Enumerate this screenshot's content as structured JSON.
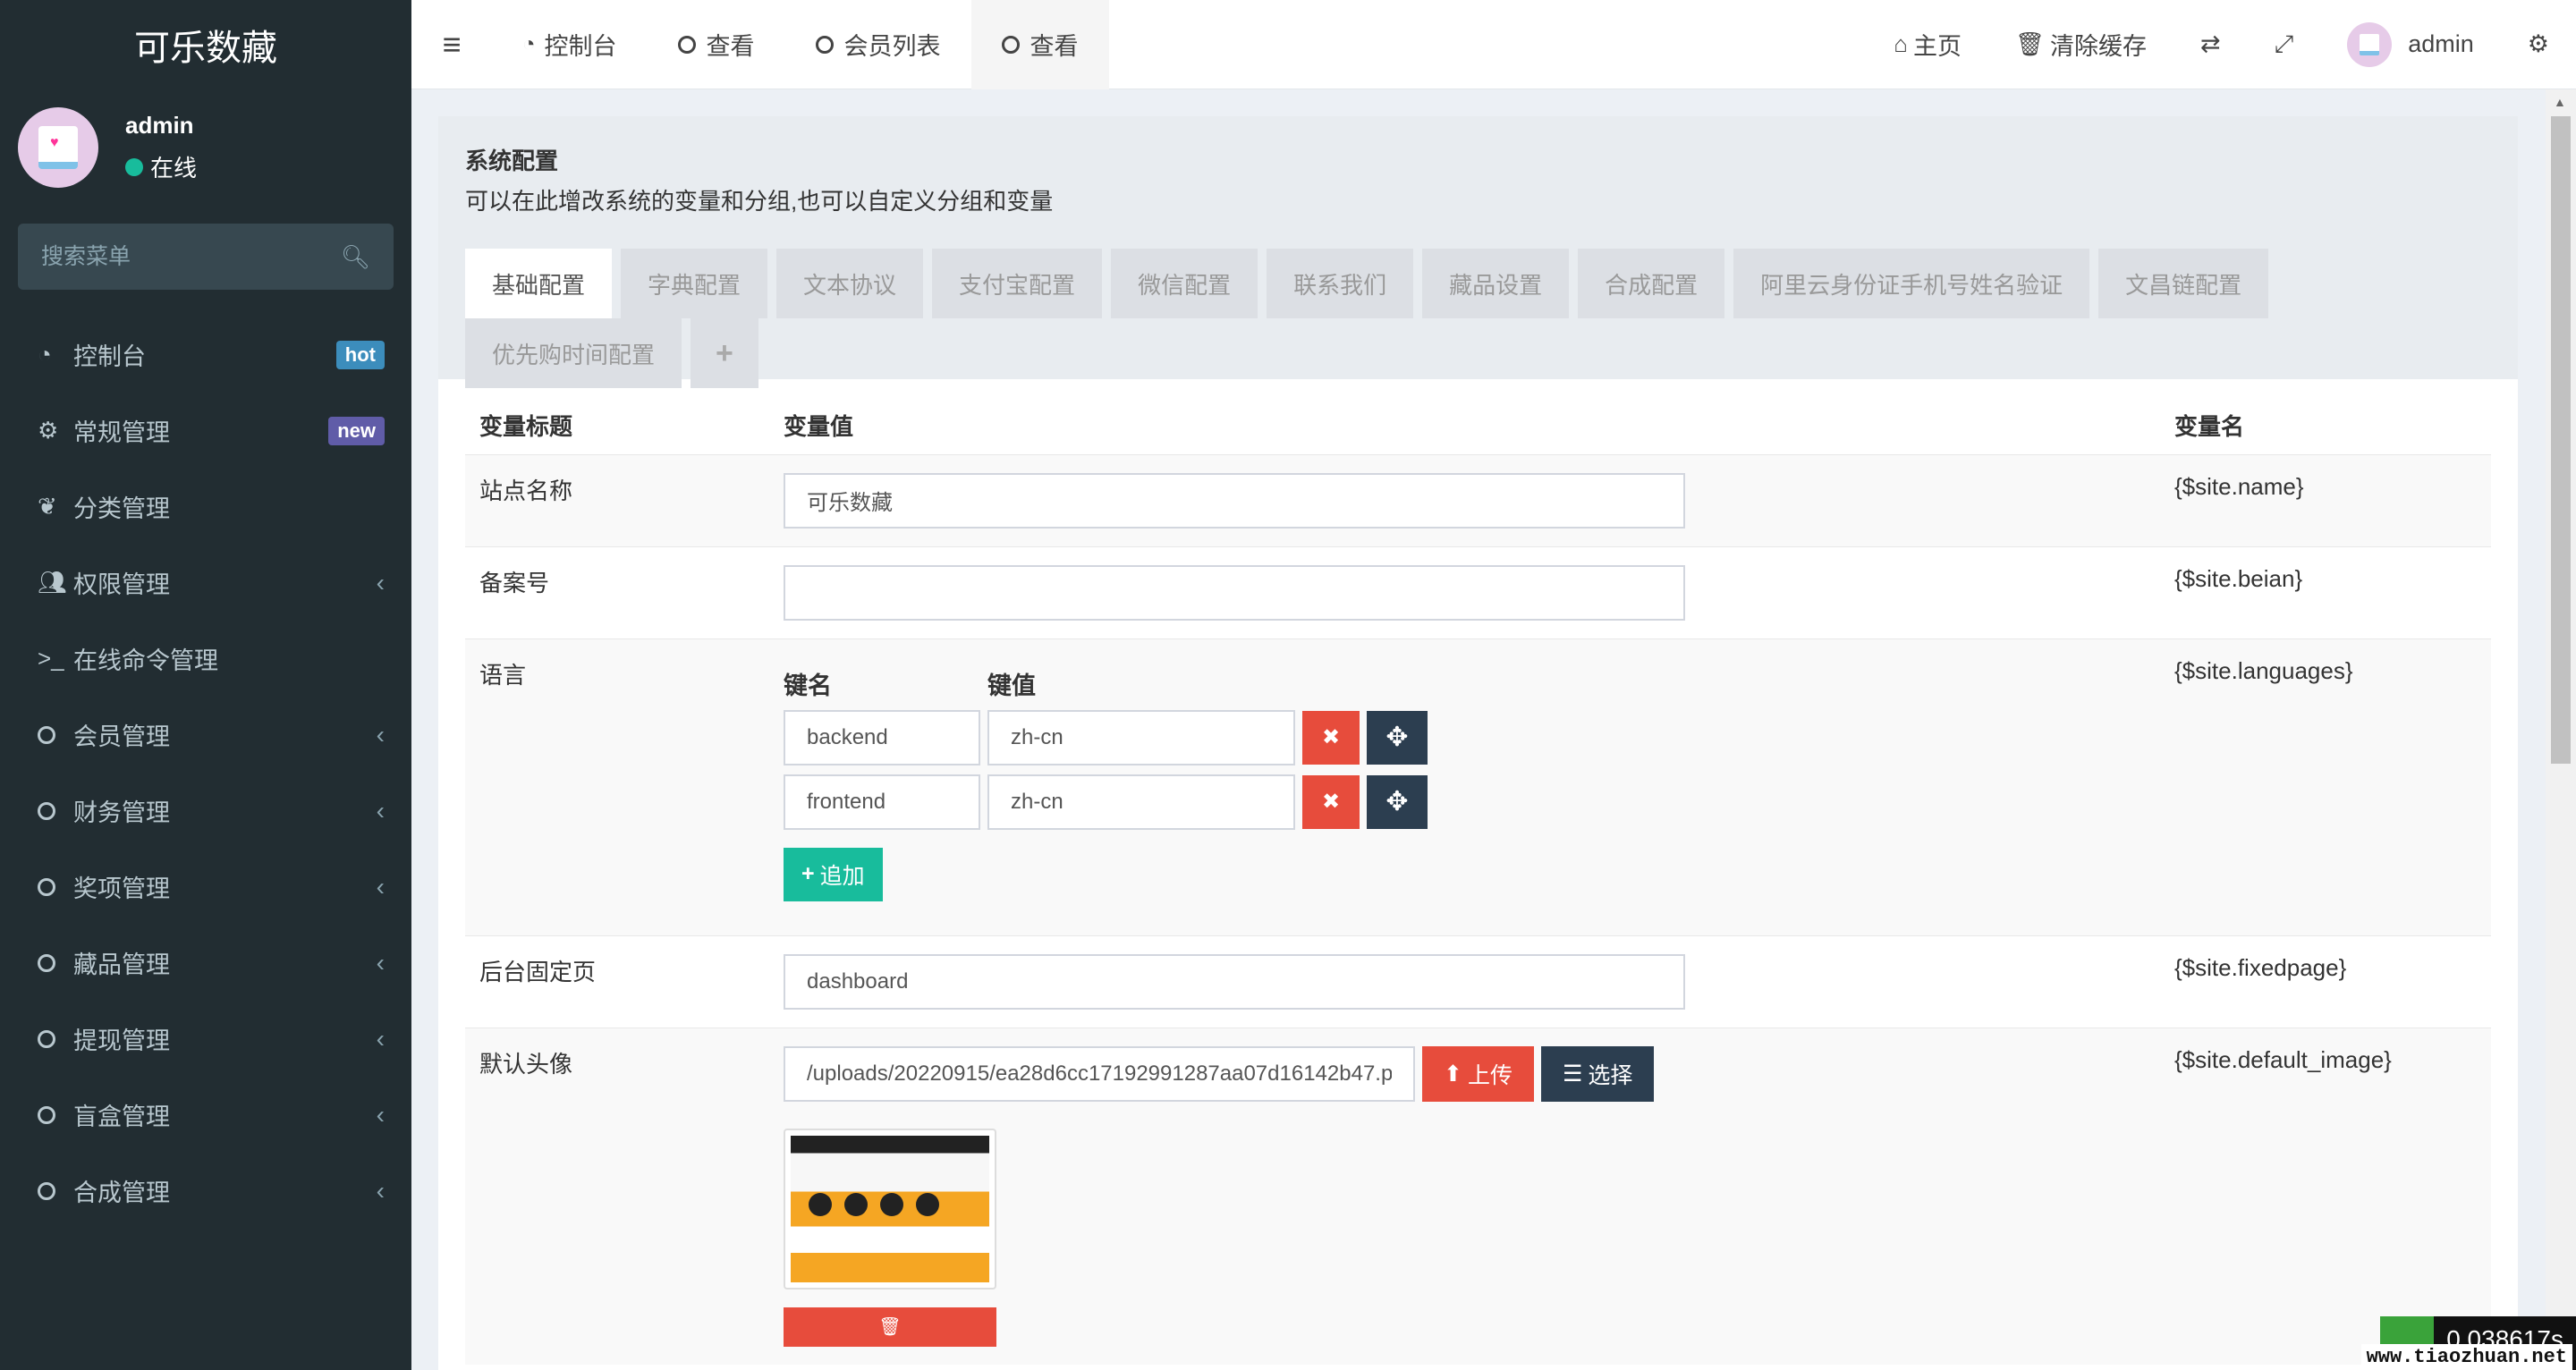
{
  "sidebar": {
    "brand": "可乐数藏",
    "user": {
      "name": "admin",
      "status": "在线"
    },
    "search_placeholder": "搜索菜单",
    "items": [
      {
        "label": "控制台",
        "badge": "hot"
      },
      {
        "label": "常规管理",
        "badge": "new"
      },
      {
        "label": "分类管理"
      },
      {
        "label": "权限管理"
      },
      {
        "label": "在线命令管理"
      },
      {
        "label": "会员管理"
      },
      {
        "label": "财务管理"
      },
      {
        "label": "奖项管理"
      },
      {
        "label": "藏品管理"
      },
      {
        "label": "提现管理"
      },
      {
        "label": "盲盒管理"
      },
      {
        "label": "合成管理"
      }
    ]
  },
  "topbar": {
    "tabs": [
      {
        "label": "控制台"
      },
      {
        "label": "查看"
      },
      {
        "label": "会员列表"
      },
      {
        "label": "查看"
      }
    ],
    "right": {
      "home": "主页",
      "clear_cache": "清除缓存",
      "user": "admin"
    }
  },
  "panel": {
    "title": "系统配置",
    "description": "可以在此增改系统的变量和分组,也可以自定义分组和变量",
    "tabs": [
      "基础配置",
      "字典配置",
      "文本协议",
      "支付宝配置",
      "微信配置",
      "联系我们",
      "藏品设置",
      "合成配置",
      "阿里云身份证手机号姓名验证",
      "文昌链配置",
      "优先购时间配置"
    ],
    "add_tab": "+"
  },
  "table": {
    "headers": {
      "title": "变量标题",
      "value": "变量值",
      "name": "变量名"
    },
    "rows": [
      {
        "title": "站点名称",
        "value": "可乐数藏",
        "var": "{$site.name}"
      },
      {
        "title": "备案号",
        "value": "",
        "var": "{$site.beian}"
      },
      {
        "title": "语言",
        "var": "{$site.languages}",
        "kv_headers": {
          "key": "键名",
          "value": "键值"
        },
        "pairs": [
          {
            "key": "backend",
            "value": "zh-cn"
          },
          {
            "key": "frontend",
            "value": "zh-cn"
          }
        ],
        "add_label": "追加"
      },
      {
        "title": "后台固定页",
        "value": "dashboard",
        "var": "{$site.fixedpage}"
      },
      {
        "title": "默认头像",
        "value": "/uploads/20220915/ea28d6cc17192991287aa07d16142b47.p",
        "var": "{$site.default_image}",
        "upload_label": "上传",
        "choose_label": "选择"
      }
    ]
  },
  "watermark": {
    "timer": "0.038617s",
    "site": "www.tiaozhuan.net"
  }
}
